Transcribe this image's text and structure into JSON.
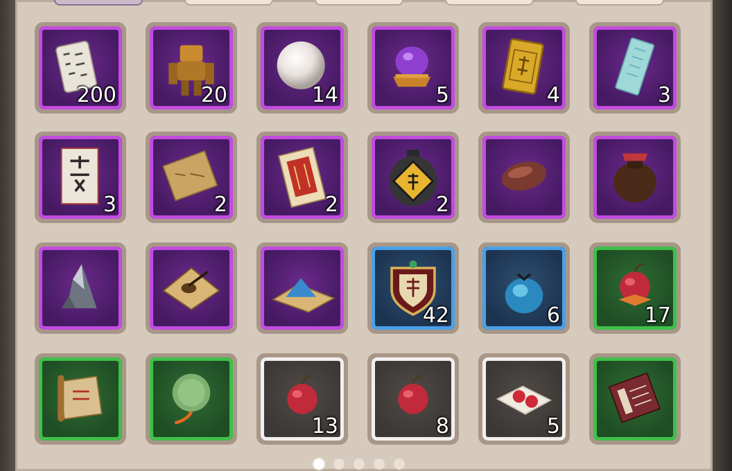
{
  "inventory": {
    "items": [
      {
        "name": "scroll-paper-icon",
        "rarity": "purple",
        "count": "200"
      },
      {
        "name": "bronze-puppet-icon",
        "rarity": "purple",
        "count": "20"
      },
      {
        "name": "pearl-icon",
        "rarity": "purple",
        "count": "14"
      },
      {
        "name": "purple-orb-stand-icon",
        "rarity": "purple",
        "count": "5"
      },
      {
        "name": "gold-token-icon",
        "rarity": "purple",
        "count": "4"
      },
      {
        "name": "jade-tablet-icon",
        "rarity": "purple",
        "count": "3"
      },
      {
        "name": "banknote-icon",
        "rarity": "purple",
        "count": "3"
      },
      {
        "name": "treasure-map-icon",
        "rarity": "purple",
        "count": "2"
      },
      {
        "name": "red-envelope-icon",
        "rarity": "purple",
        "count": "2"
      },
      {
        "name": "oil-jar-icon",
        "rarity": "purple",
        "count": "2"
      },
      {
        "name": "dried-meat-icon",
        "rarity": "purple",
        "count": ""
      },
      {
        "name": "wine-jar-icon",
        "rarity": "purple",
        "count": ""
      },
      {
        "name": "iron-ore-icon",
        "rarity": "purple",
        "count": ""
      },
      {
        "name": "ink-stone-icon",
        "rarity": "purple",
        "count": ""
      },
      {
        "name": "blue-powder-icon",
        "rarity": "purple",
        "count": ""
      },
      {
        "name": "horse-badge-icon",
        "rarity": "blue",
        "count": "42"
      },
      {
        "name": "blue-pouch-icon",
        "rarity": "blue",
        "count": "6"
      },
      {
        "name": "red-fruit-icon",
        "rarity": "green",
        "count": "17"
      },
      {
        "name": "old-scroll-icon",
        "rarity": "green",
        "count": ""
      },
      {
        "name": "jade-disc-icon",
        "rarity": "green",
        "count": ""
      },
      {
        "name": "red-fruit-icon",
        "rarity": "white",
        "count": "13"
      },
      {
        "name": "red-fruit-icon",
        "rarity": "white",
        "count": "8"
      },
      {
        "name": "fruit-on-paper-icon",
        "rarity": "white",
        "count": "5"
      },
      {
        "name": "manual-book-icon",
        "rarity": "green",
        "count": ""
      }
    ]
  },
  "pager": {
    "pages": 5,
    "current": 1
  },
  "colors": {
    "purple": "#c24ce0",
    "blue": "#4aa0e8",
    "green": "#3fc04a",
    "white": "#f2f0ee"
  }
}
